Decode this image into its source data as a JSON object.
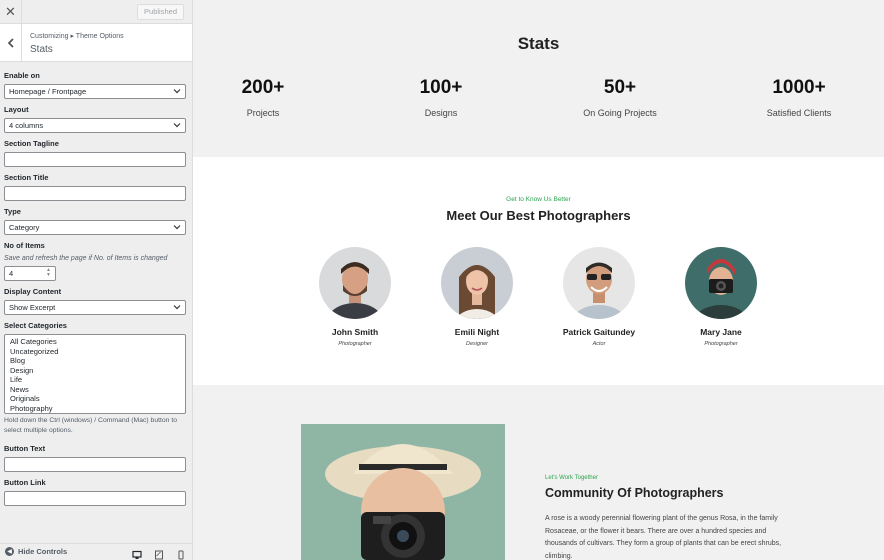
{
  "sidebar": {
    "published_label": "Published",
    "breadcrumb": "Customizing ▸ Theme Options",
    "section_title": "Stats",
    "enable_on": {
      "label": "Enable on",
      "value": "Homepage / Frontpage"
    },
    "layout": {
      "label": "Layout",
      "value": "4 columns"
    },
    "section_tagline": {
      "label": "Section Tagline",
      "value": ""
    },
    "section_title_field": {
      "label": "Section Title",
      "value": ""
    },
    "type": {
      "label": "Type",
      "value": "Category"
    },
    "no_of_items": {
      "label": "No of Items",
      "description": "Save and refresh the page if No. of Items is changed",
      "value": "4"
    },
    "display_content": {
      "label": "Display Content",
      "value": "Show Excerpt"
    },
    "select_categories": {
      "label": "Select Categories",
      "options": [
        "All Categories",
        "Uncategorized",
        "Blog",
        "Design",
        "Life",
        "News",
        "Originals",
        "Photography"
      ],
      "help": "Hold down the Ctrl (windows) / Command (Mac) button to select multiple options."
    },
    "button_text": {
      "label": "Button Text",
      "value": ""
    },
    "button_link": {
      "label": "Button Link",
      "value": ""
    },
    "footer": {
      "hide_controls": "Hide Controls"
    }
  },
  "preview": {
    "stats": {
      "title": "Stats",
      "items": [
        {
          "number": "200+",
          "label": "Projects"
        },
        {
          "number": "100+",
          "label": "Designs"
        },
        {
          "number": "50+",
          "label": "On Going Projects"
        },
        {
          "number": "1000+",
          "label": "Satisfied Clients"
        }
      ]
    },
    "team": {
      "tagline": "Get to Know Us Better",
      "title": "Meet Our Best Photographers",
      "members": [
        {
          "name": "John Smith",
          "role": "Photographer"
        },
        {
          "name": "Emili Night",
          "role": "Designer"
        },
        {
          "name": "Patrick Gaitundey",
          "role": "Actor"
        },
        {
          "name": "Mary Jane",
          "role": "Photographer"
        }
      ]
    },
    "community": {
      "tagline": "Let's Work Together",
      "title": "Community Of Photographers",
      "text": "A rose is a woody perennial flowering plant of the genus Rosa, in the family Rosaceae, or the flower it bears. There are over a hundred species and thousands of cultivars. They form a group of plants that can be erect shrubs, climbing."
    }
  },
  "colors": {
    "accent_green": "#2ea44f",
    "stats_bg": "#f1f1f1",
    "sidebar_bg": "#eeeeee"
  }
}
